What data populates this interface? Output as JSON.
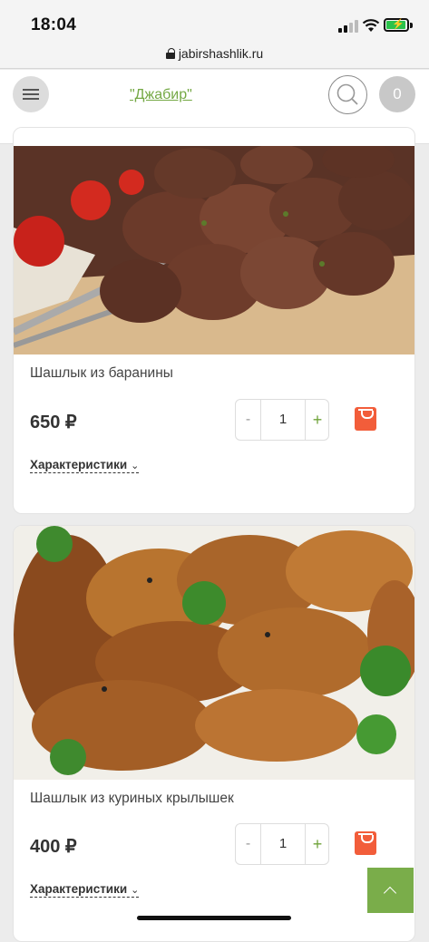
{
  "status": {
    "time": "18:04"
  },
  "browser": {
    "url": "jabirshashlik.ru"
  },
  "header": {
    "brand": "\"Джабир\"",
    "cart_count": "0"
  },
  "products": [
    {
      "name": "Шашлык из баранины",
      "price": "650 ₽",
      "qty": "1",
      "minus": "-",
      "plus": "+",
      "chars": "Характеристики",
      "chev": "⌄"
    },
    {
      "name": "Шашлык из куриных крылышек",
      "price": "400 ₽",
      "qty": "1",
      "minus": "-",
      "plus": "+",
      "chars": "Характеристики",
      "chev": "⌄"
    }
  ],
  "colors": {
    "accent": "#74a844",
    "cart_button": "#f25d3a",
    "scroll_top": "#7aad4a"
  },
  "icons": [
    "menu-icon",
    "search-icon",
    "cart-icon",
    "shopping-bag-icon",
    "chevron-up-icon",
    "lock-icon"
  ]
}
